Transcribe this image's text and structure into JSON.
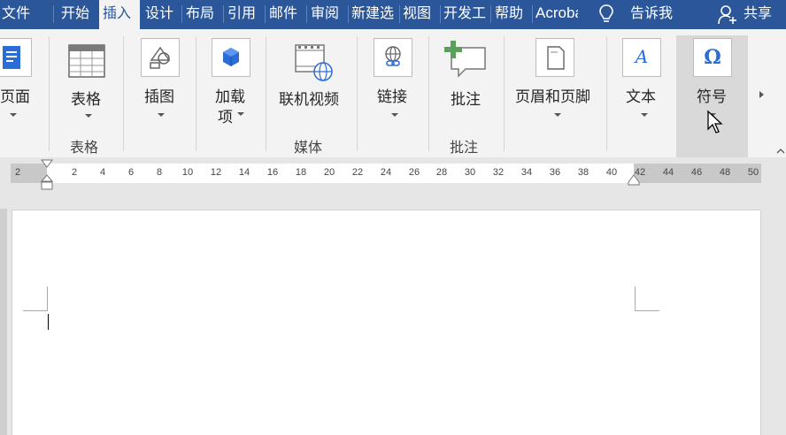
{
  "tabs": [
    {
      "label": "文件",
      "active": false
    },
    {
      "label": "开始",
      "active": false
    },
    {
      "label": "插入",
      "active": true
    },
    {
      "label": "设计",
      "active": false
    },
    {
      "label": "布局",
      "active": false
    },
    {
      "label": "引用",
      "active": false
    },
    {
      "label": "邮件",
      "active": false
    },
    {
      "label": "审阅",
      "active": false
    },
    {
      "label": "新建选",
      "active": false
    },
    {
      "label": "视图",
      "active": false
    },
    {
      "label": "开发工",
      "active": false
    },
    {
      "label": "帮助",
      "active": false
    },
    {
      "label": "Acrobat",
      "active": false
    }
  ],
  "tell_me": "告诉我",
  "share": "共享",
  "ribbon": {
    "pages": "页面",
    "table": "表格",
    "illustrations": "插图",
    "addins_line1": "加载",
    "addins_line2": "项",
    "online_video": "联机视频",
    "link": "链接",
    "comment": "批注",
    "header_footer": "页眉和页脚",
    "text": "文本",
    "symbols": "符号",
    "groups": {
      "table": "表格",
      "media": "媒体",
      "comments": "批注"
    }
  },
  "ruler_ticks": [
    "2",
    "2",
    "4",
    "6",
    "8",
    "10",
    "12",
    "14",
    "16",
    "18",
    "20",
    "22",
    "24",
    "26",
    "28",
    "30",
    "32",
    "34",
    "36",
    "38",
    "40",
    "42",
    "44",
    "46",
    "48",
    "50"
  ],
  "colors": {
    "title_bar": "#2b579a",
    "ribbon_bg": "#f3f3f3",
    "selected_button": "#d9d9d9",
    "icon_blue": "#2b6cd6",
    "comment_green": "#5aa05a"
  }
}
